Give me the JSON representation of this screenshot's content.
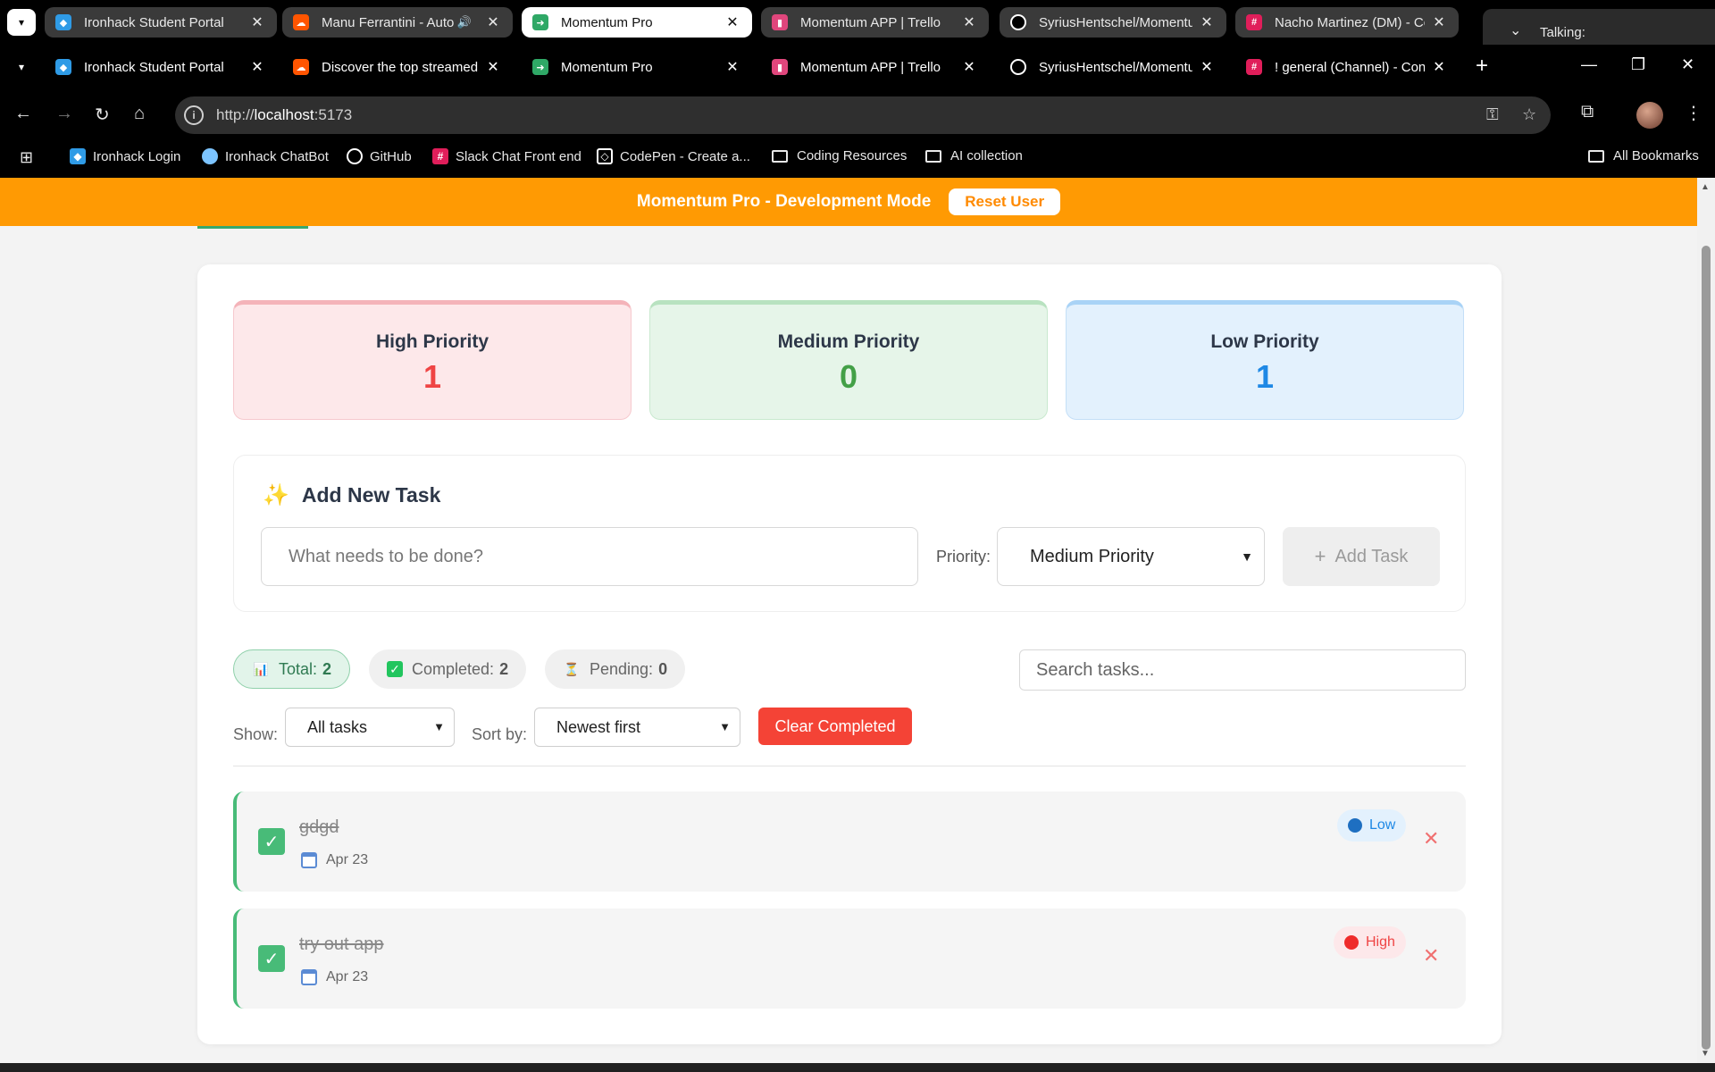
{
  "tabs_row1": [
    {
      "title": "Ironhack Student Portal",
      "color": "#2f9be6"
    },
    {
      "title": "Manu Ferrantini - Auto",
      "color": "#ff5500"
    },
    {
      "title": "Momentum Pro",
      "color": "#2fa866"
    },
    {
      "title": "Momentum APP | Trello",
      "color": "#e0467c"
    },
    {
      "title": "SyriusHentschel/Momentu",
      "color": "#ffffff"
    },
    {
      "title": "Nacho Martinez (DM) - Co",
      "color": "#e01e5a"
    }
  ],
  "tabs_row2": [
    {
      "title": "Ironhack Student Portal",
      "color": "#2f9be6"
    },
    {
      "title": "Discover the top streamed",
      "color": "#ff5500"
    },
    {
      "title": "Momentum Pro",
      "color": "#2fa866"
    },
    {
      "title": "Momentum APP | Trello",
      "color": "#e0467c"
    },
    {
      "title": "SyriusHentschel/Momentu",
      "color": "#ffffff"
    },
    {
      "title": "! general (Channel) - Cons",
      "color": "#e01e5a"
    }
  ],
  "talking_label": "Talking:",
  "omnibox": {
    "scheme": "http://",
    "host": "localhost",
    "port": ":5173"
  },
  "bookmarks": [
    {
      "label": "Ironhack Login",
      "icon": "ironhack-icon"
    },
    {
      "label": "Ironhack ChatBot",
      "icon": "chat-bubble-icon"
    },
    {
      "label": "GitHub",
      "icon": "github-icon"
    },
    {
      "label": "Slack Chat Front end",
      "icon": "slack-icon"
    },
    {
      "label": "CodePen - Create a...",
      "icon": "codepen-icon"
    },
    {
      "label": "Coding Resources",
      "icon": "folder-icon"
    },
    {
      "label": "AI collection",
      "icon": "folder-icon"
    },
    {
      "label": "All Bookmarks",
      "icon": "folder-icon"
    }
  ],
  "devbar": {
    "title": "Momentum Pro - Development Mode",
    "reset_label": "Reset User"
  },
  "stats": {
    "high": {
      "label": "High Priority",
      "count": "1"
    },
    "medium": {
      "label": "Medium Priority",
      "count": "0"
    },
    "low": {
      "label": "Low Priority",
      "count": "1"
    }
  },
  "add_task": {
    "heading": "Add New Task",
    "placeholder": "What needs to be done?",
    "priority_label": "Priority:",
    "priority_value": "Medium Priority",
    "button_label": "Add Task"
  },
  "summary": {
    "total_label": "Total:",
    "total": "2",
    "completed_label": "Completed:",
    "completed": "2",
    "pending_label": "Pending:",
    "pending": "0"
  },
  "search_placeholder": "Search tasks...",
  "filters": {
    "show_label": "Show:",
    "show_value": "All tasks",
    "sort_label": "Sort by:",
    "sort_value": "Newest first",
    "clear_label": "Clear Completed"
  },
  "tasks": [
    {
      "title": "gdgd",
      "date": "Apr 23",
      "priority": "Low",
      "completed": true
    },
    {
      "title": "try out app",
      "date": "Apr 23",
      "priority": "High",
      "completed": true
    }
  ],
  "colors": {
    "accent_orange": "#ff9a03",
    "success_green": "#48bb78",
    "danger_red": "#f44336"
  }
}
